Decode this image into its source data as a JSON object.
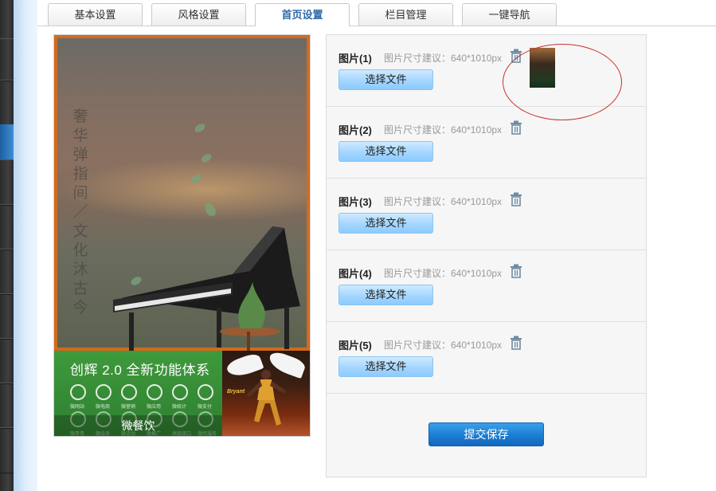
{
  "tabs": [
    {
      "label": "基本设置",
      "active": false
    },
    {
      "label": "风格设置",
      "active": false
    },
    {
      "label": "首页设置",
      "active": true
    },
    {
      "label": "栏目管理",
      "active": false
    },
    {
      "label": "一键导航",
      "active": false
    }
  ],
  "preview": {
    "vertical_text": "奢华弹指间／文化沐古今",
    "banner_title": "创辉 2.0 全新功能体系",
    "banner_footer": "微餐饮",
    "icon_labels": [
      "微网站",
      "微电商",
      "微营销",
      "微应用",
      "微统计",
      "微支付",
      "微哥哥",
      "微会员",
      "微活动",
      "微推广",
      "高级接口",
      "微民服务"
    ],
    "photo_text": "Bryant"
  },
  "images": [
    {
      "label": "图片(1)",
      "hint": "图片尺寸建议：640*1010px",
      "button": "选择文件",
      "has_thumbnail": true
    },
    {
      "label": "图片(2)",
      "hint": "图片尺寸建议：640*1010px",
      "button": "选择文件",
      "has_thumbnail": false
    },
    {
      "label": "图片(3)",
      "hint": "图片尺寸建议：640*1010px",
      "button": "选择文件",
      "has_thumbnail": false
    },
    {
      "label": "图片(4)",
      "hint": "图片尺寸建议：640*1010px",
      "button": "选择文件",
      "has_thumbnail": false
    },
    {
      "label": "图片(5)",
      "hint": "图片尺寸建议：640*1010px",
      "button": "选择文件",
      "has_thumbnail": false
    }
  ],
  "submit_label": "提交保存",
  "colors": {
    "accent_tab": "#2d6aa8",
    "frame_orange": "#d36a1c",
    "banner_green": "#3e9a3c",
    "submit_blue": "#1a7ad0",
    "annotation_red": "#c83030"
  }
}
